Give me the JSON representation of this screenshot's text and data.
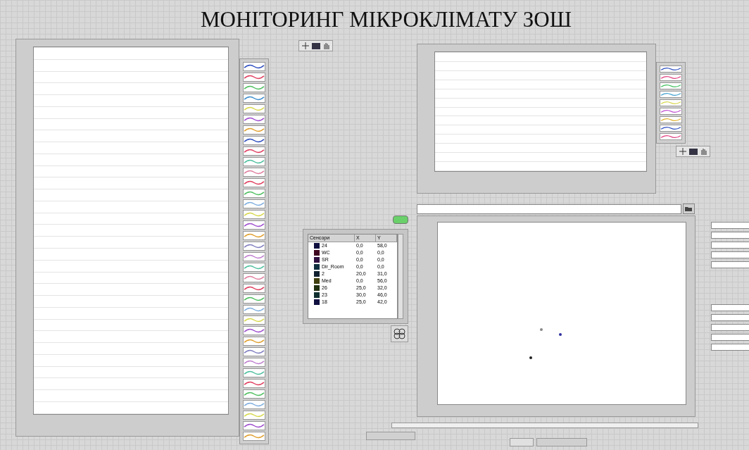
{
  "title": "МОНІТОРИНГ МІКРОКЛІМАТУ ЗОШ",
  "left_chart": {
    "legend": [
      {
        "color": "#3050c0"
      },
      {
        "color": "#e04060"
      },
      {
        "color": "#50c060"
      },
      {
        "color": "#4090d0"
      },
      {
        "color": "#d8d850"
      },
      {
        "color": "#a050d0"
      },
      {
        "color": "#e0a030"
      },
      {
        "color": "#3050c0"
      },
      {
        "color": "#e04060"
      },
      {
        "color": "#50c0a0"
      },
      {
        "color": "#e080a0"
      },
      {
        "color": "#e04060"
      },
      {
        "color": "#50c060"
      },
      {
        "color": "#80b0e0"
      },
      {
        "color": "#d8d850"
      },
      {
        "color": "#a050d0"
      },
      {
        "color": "#e0a030"
      },
      {
        "color": "#8080c0"
      },
      {
        "color": "#c080d0"
      },
      {
        "color": "#50c0a0"
      },
      {
        "color": "#e080a0"
      },
      {
        "color": "#e04060"
      },
      {
        "color": "#50c060"
      },
      {
        "color": "#80b0e0"
      },
      {
        "color": "#d8d850"
      },
      {
        "color": "#a050d0"
      },
      {
        "color": "#e0a030"
      },
      {
        "color": "#8080c0"
      },
      {
        "color": "#c080d0"
      },
      {
        "color": "#50c0a0"
      },
      {
        "color": "#e04060"
      },
      {
        "color": "#50c060"
      },
      {
        "color": "#80b0e0"
      },
      {
        "color": "#d8d850"
      },
      {
        "color": "#a050d0"
      },
      {
        "color": "#e0a030"
      }
    ]
  },
  "right_chart": {
    "legend": [
      {
        "color": "#3050c0"
      },
      {
        "color": "#e04080"
      },
      {
        "color": "#40c060"
      },
      {
        "color": "#40a0d0"
      },
      {
        "color": "#d8d850"
      },
      {
        "color": "#c050d0"
      },
      {
        "color": "#e0b030"
      },
      {
        "color": "#3050c0"
      },
      {
        "color": "#e04080"
      }
    ]
  },
  "indicator": {
    "on": true
  },
  "table": {
    "columns": [
      "Сенсори",
      "X",
      "Y"
    ],
    "rows": [
      {
        "color": "#101040",
        "cells": [
          "24",
          "0,0",
          "58,0"
        ]
      },
      {
        "color": "#400820",
        "cells": [
          "WC",
          "0,0",
          "0,0"
        ]
      },
      {
        "color": "#301040",
        "cells": [
          "SR",
          "0,0",
          "0,0"
        ]
      },
      {
        "color": "#103040",
        "cells": [
          "Dir_Room",
          "0,0",
          "0,0"
        ]
      },
      {
        "color": "#102030",
        "cells": [
          "2",
          "20,0",
          "31,0"
        ]
      },
      {
        "color": "#404010",
        "cells": [
          "Med",
          "0,0",
          "56,0"
        ]
      },
      {
        "color": "#203010",
        "cells": [
          "26",
          "25,0",
          "32,0"
        ]
      },
      {
        "color": "#103030",
        "cells": [
          "23",
          "30,0",
          "46,0"
        ]
      },
      {
        "color": "#101040",
        "cells": [
          "18",
          "25,0",
          "42,0"
        ]
      }
    ]
  },
  "scatter": {
    "points": [
      {
        "color": "#888888"
      },
      {
        "color": "#3030a0"
      },
      {
        "color": "#202020"
      }
    ]
  }
}
